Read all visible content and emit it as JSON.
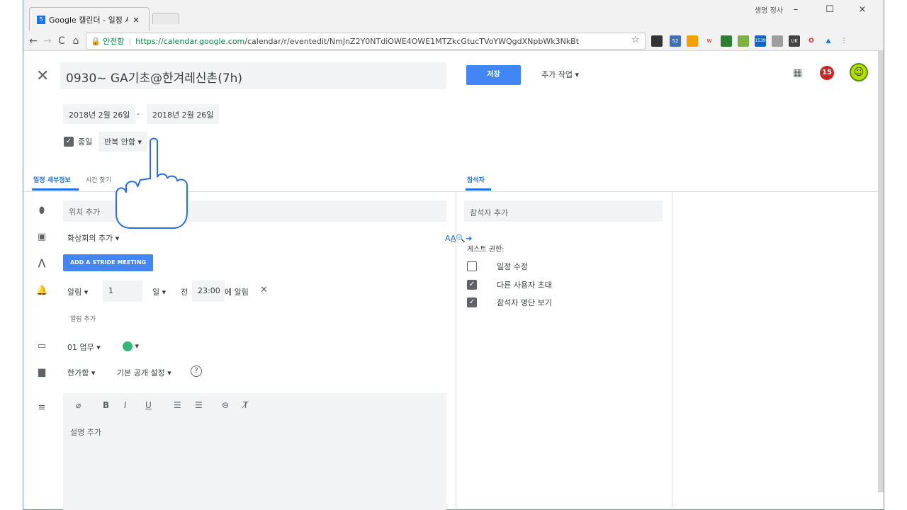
{
  "browser": {
    "tab_title": "Google 캘린더 - 일정 세",
    "tab_favicon": "5",
    "tab_close": "×",
    "window_user": "생명 정사",
    "window_min": "–",
    "window_max": "☐",
    "window_close": "×",
    "nav_back": "←",
    "nav_forward": "→",
    "nav_reload": "C",
    "nav_home": "⌂",
    "secure_label": "🔒 안전함",
    "url_host": "https://calendar.google.com",
    "url_path": "/calendar/r/eventedit/NmJnZ2Y0NTdiOWE4OWE1MTZkcGtucTVoYWQgdXNpbWk3NkBt",
    "star": "☆",
    "ext_badge_1": "52",
    "ext_badge_2": "1539",
    "ext_badge_3": "UK"
  },
  "event": {
    "title": "0930~ GA기초@한겨레신촌(7h)",
    "save_label": "저장",
    "more_actions_label": "추가 작업 ▾",
    "notif_count": "15",
    "start_date": "2018년 2월 26일",
    "date_separator": "-",
    "end_date": "2018년 2월 26일",
    "allday_label": "종일",
    "allday_check": "✓",
    "repeat_label": "반복 안함 ▾"
  },
  "tabs": {
    "details": "일정 세부정보",
    "find_time": "시간 찾기",
    "guests": "참석자"
  },
  "details": {
    "location_placeholder": "위치 추가",
    "video_label": "화상회의 추가 ▾",
    "stride_label": "ADD A STRIDE MEETING",
    "notif_type": "알림 ▾",
    "notif_value": "1",
    "notif_unit": "일 ▾",
    "notif_before": "전",
    "notif_time": "23:00",
    "notif_suffix": "에 알림",
    "notif_remove": "✕",
    "add_notif": "알림 추가",
    "calendar_name": "01 업무 ▾",
    "color_caret": "▾",
    "busy_label": "한가함 ▾",
    "visibility_label": "기본 공개 설정 ▾",
    "help": "?",
    "description_placeholder": "설명 추가",
    "format_bold": "B",
    "format_italic": "I",
    "format_underline": "U",
    "format_ol": "☰",
    "format_ul": "☰",
    "format_link": "⊖",
    "format_clear": "T̸",
    "attach": "⌀"
  },
  "guests": {
    "add_placeholder": "참석자 추가",
    "permissions_label": "게스트 권한:",
    "permissions": [
      {
        "label": "일정 수정",
        "checked": false
      },
      {
        "label": "다른 사용자 초대",
        "checked": true
      },
      {
        "label": "참석자 명단 보기",
        "checked": true
      }
    ],
    "check_mark": "✓"
  },
  "colors": {
    "accent": "#4285f4",
    "event_color": "#33b679",
    "badge": "#c62828"
  }
}
